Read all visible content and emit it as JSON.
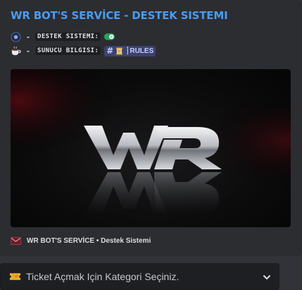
{
  "embed": {
    "title": "WR BOT'S SERVİCE - DESTEK SISTEMI",
    "fields": [
      {
        "icon": "globe-icon",
        "separator": "-",
        "label": "DESTEK SISTEMI:",
        "value_icon": "toggle-on-icon"
      },
      {
        "icon": "coffee-cup-icon",
        "separator": "-",
        "label": "SUNUCU BILGISI:",
        "channel": {
          "icon": "scroll-icon",
          "name": "┆RULES"
        }
      }
    ],
    "image": {
      "logo_text": "WR"
    },
    "footer": {
      "icon": "envelope-icon",
      "text": "WR BOT'S SERVİCE • Destek Sistemi"
    }
  },
  "select_menu": {
    "icon": "ticket-icon",
    "placeholder": "Ticket Açmak Için Kategori Seçiniz.",
    "chevron": "chevron-down-icon"
  },
  "colors": {
    "title": "#4a9cf0",
    "embed_bg": "#2b2d31",
    "page_bg": "#313338",
    "toggle": "#23a55a",
    "channel_bg": "#3c4270"
  }
}
